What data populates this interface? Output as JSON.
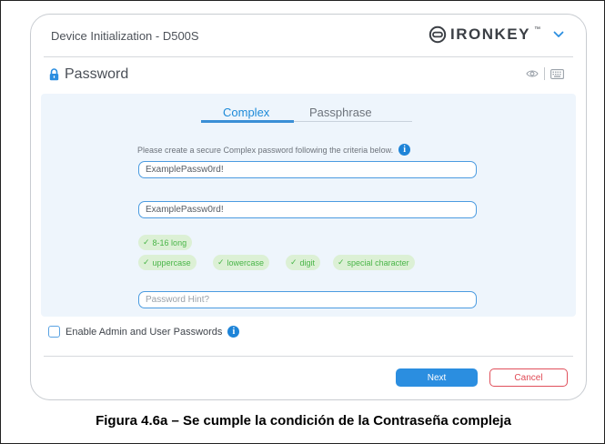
{
  "window": {
    "title": "Device Initialization - D500S",
    "brand": "IRONKEY",
    "brand_tm": "™"
  },
  "section": {
    "title": "Password"
  },
  "tabs": [
    {
      "label": "Complex",
      "active": true
    },
    {
      "label": "Passphrase",
      "active": false
    }
  ],
  "form": {
    "instructions": "Please create a secure Complex password following the criteria below.",
    "password_value": "ExamplePassw0rd!",
    "confirm_value": "ExamplePassw0rd!",
    "hint_placeholder": "Password Hint?",
    "criteria": [
      {
        "label": "8-16 long",
        "met": true
      },
      {
        "label": "uppercase",
        "met": true
      },
      {
        "label": "lowercase",
        "met": true
      },
      {
        "label": "digit",
        "met": true
      },
      {
        "label": "special character",
        "met": true
      }
    ]
  },
  "options": {
    "admin_user_label": "Enable Admin and User Passwords",
    "admin_user_checked": false
  },
  "buttons": {
    "next": "Next",
    "cancel": "Cancel"
  },
  "caption": "Figura 4.6a – Se cumple la condición de la Contraseña compleja",
  "colors": {
    "accent": "#2b8ee0",
    "success": "#49b548",
    "cancel": "#e04a55"
  }
}
